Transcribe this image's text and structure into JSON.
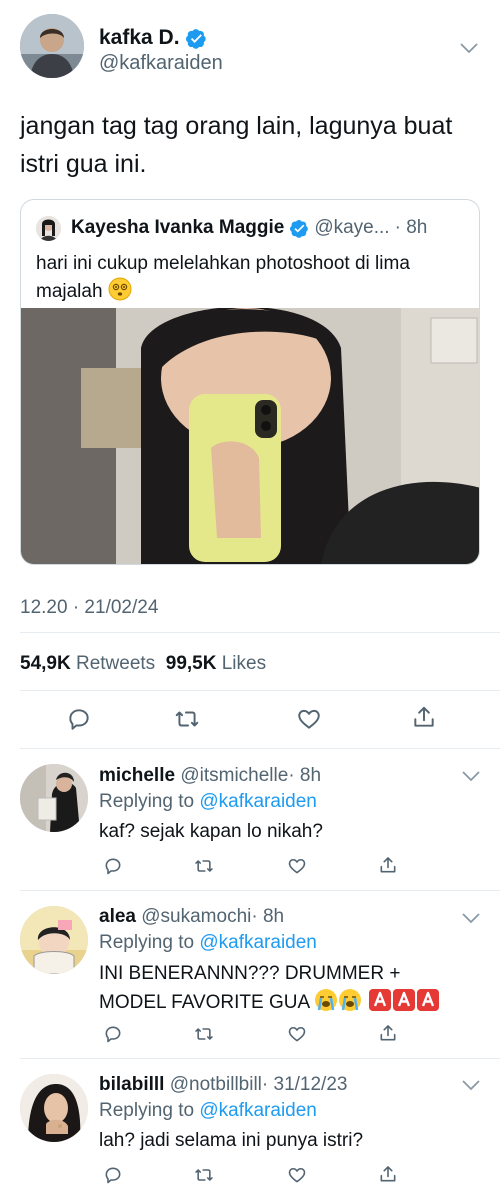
{
  "tweet": {
    "author_name": "kafka D.",
    "author_handle": "@kafkaraiden",
    "text": "jangan tag tag orang lain, lagunya buat istri gua ini.",
    "timestamp": "12.20 · 21/02/24",
    "retweets_count": "54,9K",
    "retweets_label": "Retweets",
    "likes_count": "99,5K",
    "likes_label": "Likes"
  },
  "quoted_tweet": {
    "author_name": "Kayesha Ivanka Maggie",
    "author_handle": "@kaye...",
    "time": "· 8h",
    "text": "hari ini cukup melelahkan photoshoot di lima majalah"
  },
  "replies": [
    {
      "name": "michelle",
      "handle": "@itsmichelle",
      "time": "· 8h",
      "replying_label": "Replying to",
      "replying_to": "@kafkaraiden",
      "text": "kaf? sejak kapan lo nikah?"
    },
    {
      "name": "alea",
      "handle": "@sukamochi",
      "time": "· 8h",
      "replying_label": "Replying to",
      "replying_to": "@kafkaraiden",
      "text_line1": "INI BENERANNN??? DRUMMER +",
      "text_line2": "MODEL FAVORITE GUA"
    },
    {
      "name": "bilabilll",
      "handle": "@notbillbill",
      "time": "· 31/12/23",
      "replying_label": "Replying to",
      "replying_to": "@kafkaraiden",
      "text": "lah? jadi selama ini punya istri?"
    }
  ],
  "icons": {
    "reply": "reply-icon",
    "retweet": "retweet-icon",
    "like": "heart-icon",
    "share": "share-icon",
    "verified": "verified-badge-icon",
    "more": "chevron-down-icon"
  },
  "colors": {
    "text": "#0f1419",
    "secondary": "#536471",
    "accent": "#1d9bf0",
    "divider": "#e6ecf0"
  }
}
